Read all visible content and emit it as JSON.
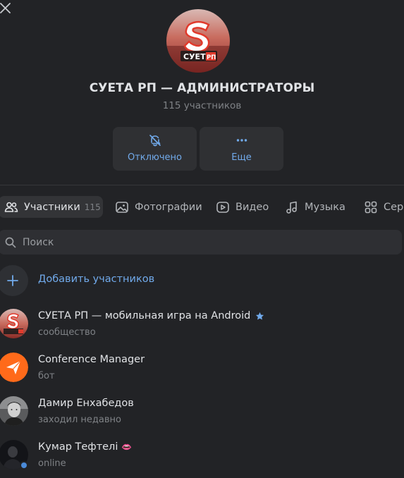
{
  "header": {
    "title": "СУЕТА РП — АДМИНИСТРАТОРЫ",
    "subtitle": "115 участников",
    "cover_logo_text": "СУЕТА",
    "cover_logo_badge": "РП"
  },
  "actions": [
    {
      "label": "Отключено",
      "icon": "bell-off-icon"
    },
    {
      "label": "Еще",
      "icon": "more-icon"
    }
  ],
  "tabs": [
    {
      "label": "Участники",
      "count": "115",
      "icon": "users-icon",
      "active": true
    },
    {
      "label": "Фотографии",
      "icon": "photo-icon"
    },
    {
      "label": "Видео",
      "icon": "video-icon"
    },
    {
      "label": "Музыка",
      "icon": "music-icon"
    },
    {
      "label": "Сервисы",
      "icon": "services-icon"
    }
  ],
  "search": {
    "placeholder": "Поиск"
  },
  "add_members": {
    "label": "Добавить участников"
  },
  "members": [
    {
      "name": "СУЕТА РП — мобильная игра на Android",
      "sub": "сообщество",
      "badge": "star-icon"
    },
    {
      "name": "Conference Manager",
      "sub": "бот"
    },
    {
      "name": "Дамир Енхабедов",
      "sub": "заходил недавно"
    },
    {
      "name": "Кумар Тефтелі",
      "sub": "online",
      "emoji": "👄",
      "online": true
    }
  ],
  "colors": {
    "accent": "#71aaeb",
    "background": "#222326",
    "surface": "#2f3033"
  }
}
